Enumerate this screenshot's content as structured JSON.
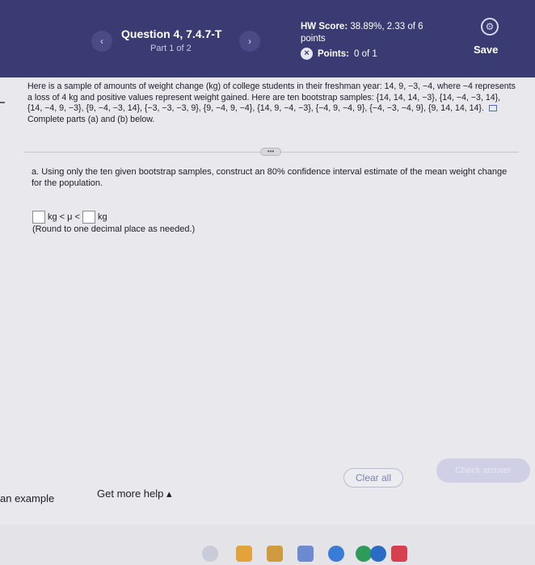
{
  "header": {
    "prev_icon": "chevron-left-icon",
    "prev_glyph": "‹",
    "next_icon": "chevron-right-icon",
    "next_glyph": "›",
    "question_title": "Question 4, 7.4.7-T",
    "part_label": "Part 1 of 2",
    "hw_score_label": "HW Score:",
    "hw_score_value": "38.89%, 2.33 of 6 points",
    "points_label": "Points:",
    "points_value": "0 of 1",
    "x_glyph": "×",
    "gear_glyph": "⚙",
    "save_label": "Save"
  },
  "problem": {
    "text": "Here is a sample of amounts of weight change (kg) of college students in their freshman year: 14, 9, −3, −4, where −4 represents a loss of 4 kg and positive values represent weight gained. Here are ten bootstrap samples: {14, 14, 14, −3}, {14, −4, −3, 14}, {14, −4, 9, −3}, {9, −4, −3, 14}, {−3, −3, −3, 9}, {9, −4, 9, −4}, {14, 9, −4, −3}, {−4, 9, −4, 9}, {−4, −3, −4, 9}, {9, 14, 14, 14}.",
    "complete_text": "Complete parts (a) and (b) below."
  },
  "more_glyph": "•••",
  "part_a": {
    "question": "a. Using only the ten given bootstrap samples, construct an 80% confidence interval estimate of the mean weight change for the population.",
    "unit_left": "kg",
    "middle": "< μ <",
    "unit_right": "kg",
    "round_note": "(Round to one decimal place as needed.)"
  },
  "footer": {
    "clear_all": "Clear all",
    "check_answer": "Check answer",
    "example_link": "an example",
    "help_link": "Get more help",
    "help_caret": "▴"
  },
  "colors": {
    "header_bg": "#3a3b72",
    "accent": "#4b6fb8"
  }
}
